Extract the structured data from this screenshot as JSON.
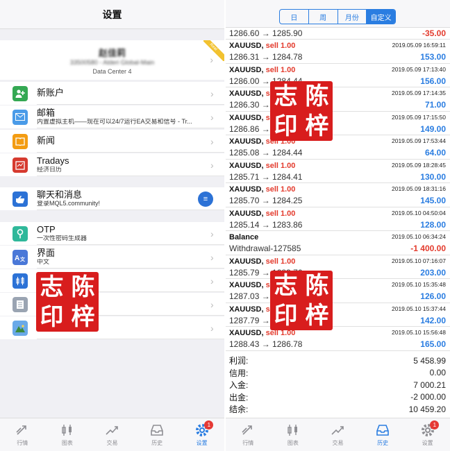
{
  "left": {
    "title": "设置",
    "account": {
      "name": "赵佳莉",
      "number_server": "33500580 - Alderi Global-Main",
      "datacenter": "Data Center 4",
      "ribbon": "Real"
    },
    "items": [
      {
        "id": "new-account",
        "label": "新账户",
        "sub": "",
        "icon": "user-plus-icon",
        "color": "#34a853"
      },
      {
        "id": "mailbox",
        "label": "邮箱",
        "sub": "内置虚拟主机——现在可以24/7运行EA交易和信号 - Tr...",
        "icon": "envelope-icon",
        "color": "#4a9be8"
      },
      {
        "id": "news",
        "label": "新闻",
        "sub": "",
        "icon": "book-icon",
        "color": "#f39c12"
      },
      {
        "id": "tradays",
        "label": "Tradays",
        "sub": "经济日历",
        "icon": "calendar-icon",
        "color": "#d63a2f"
      },
      {
        "id": "chat",
        "label": "聊天和消息",
        "sub": "登录MQL5.community!",
        "icon": "hand-icon",
        "color": "#2c72d6"
      },
      {
        "id": "otp",
        "label": "OTP",
        "sub": "一次性密码生成器",
        "icon": "key-icon",
        "color": "#2fb89a"
      },
      {
        "id": "interface",
        "label": "界面",
        "sub": "中文",
        "icon": "language-icon",
        "color": "#4a78d8"
      },
      {
        "id": "charts",
        "label": "",
        "sub": "",
        "icon": "candles-icon",
        "color": "#2c72d6"
      },
      {
        "id": "journal",
        "label": "",
        "sub": "",
        "icon": "document-icon",
        "color": "#9aa4b2"
      },
      {
        "id": "about",
        "label": "",
        "sub": "",
        "icon": "mountain-icon",
        "color": "#6aa9e8"
      }
    ],
    "stamp": [
      "志",
      "陈",
      "印",
      "梓"
    ]
  },
  "tabs": [
    {
      "label": "行情",
      "icon": "arrows-icon"
    },
    {
      "label": "图表",
      "icon": "candles-icon"
    },
    {
      "label": "交易",
      "icon": "trend-icon"
    },
    {
      "label": "历史",
      "icon": "inbox-icon"
    },
    {
      "label": "设置",
      "icon": "gear-icon",
      "badge": "1"
    }
  ],
  "right": {
    "segments": [
      "日",
      "周",
      "月份",
      "自定义"
    ],
    "active_segment": 3,
    "first_row": {
      "prices": "1286.60 → 1285.90",
      "profit": "-35.00"
    },
    "trades": [
      {
        "symbol": "XAUUSD,",
        "action": "sell 1.00",
        "date": "2019.05.09 16:59:11",
        "prices": "1286.31 → 1284.78",
        "profit": "153.00",
        "sign": "pos"
      },
      {
        "symbol": "XAUUSD,",
        "action": "sell 1.00",
        "date": "2019.05.09 17:13:40",
        "prices": "1286.00 → 1284.44",
        "profit": "156.00",
        "sign": "pos"
      },
      {
        "symbol": "XAUUSD,",
        "action": "sell 1.00",
        "date": "2019.05.09 17:14:35",
        "prices": "1286.30 → 1285.59",
        "profit": "71.00",
        "sign": "pos"
      },
      {
        "symbol": "XAUUSD,",
        "action": "sell 1.00",
        "date": "2019.05.09 17:15:50",
        "prices": "1286.86 → 1285.37",
        "profit": "149.00",
        "sign": "pos"
      },
      {
        "symbol": "XAUUSD,",
        "action": "sell 1.00",
        "date": "2019.05.09 17:53:44",
        "prices": "1285.08 → 1284.44",
        "profit": "64.00",
        "sign": "pos"
      },
      {
        "symbol": "XAUUSD,",
        "action": "sell 1.00",
        "date": "2019.05.09 18:28:45",
        "prices": "1285.71 → 1284.41",
        "profit": "130.00",
        "sign": "pos"
      },
      {
        "symbol": "XAUUSD,",
        "action": "sell 1.00",
        "date": "2019.05.09 18:31:16",
        "prices": "1285.70 → 1284.25",
        "profit": "145.00",
        "sign": "pos"
      },
      {
        "symbol": "XAUUSD,",
        "action": "sell 1.00",
        "date": "2019.05.10 04:50:04",
        "prices": "1285.14 → 1283.86",
        "profit": "128.00",
        "sign": "pos"
      },
      {
        "symbol": "Balance",
        "action": "",
        "date": "2019.05.10 06:34:24",
        "prices": "Withdrawal-127585",
        "profit": "-1 400.00",
        "sign": "neg"
      },
      {
        "symbol": "XAUUSD,",
        "action": "sell 1.00",
        "date": "2019.05.10 07:16:07",
        "prices": "1285.79 → 1283.76",
        "profit": "203.00",
        "sign": "pos"
      },
      {
        "symbol": "XAUUSD,",
        "action": "sell 1.00",
        "date": "2019.05.10 15:35:48",
        "prices": "1287.03 → 1285.77",
        "profit": "126.00",
        "sign": "pos"
      },
      {
        "symbol": "XAUUSD,",
        "action": "sell 1.00",
        "date": "2019.05.10 15:37:44",
        "prices": "1287.79 → 1286.37",
        "profit": "142.00",
        "sign": "pos"
      },
      {
        "symbol": "XAUUSD,",
        "action": "sell 1.00",
        "date": "2019.05.10 15:56:48",
        "prices": "1288.43 → 1286.78",
        "profit": "165.00",
        "sign": "pos"
      }
    ],
    "summary": [
      {
        "label": "利润:",
        "value": "5 458.99"
      },
      {
        "label": "信用:",
        "value": "0.00"
      },
      {
        "label": "入金:",
        "value": "7 000.21"
      },
      {
        "label": "出金:",
        "value": "-2 000.00"
      },
      {
        "label": "结余:",
        "value": "10 459.20"
      }
    ],
    "stamp": [
      "志",
      "陈",
      "印",
      "梓"
    ]
  },
  "colors": {
    "accent": "#2a7de1",
    "sell": "#e33a2c",
    "stamp": "#d81d1d"
  }
}
